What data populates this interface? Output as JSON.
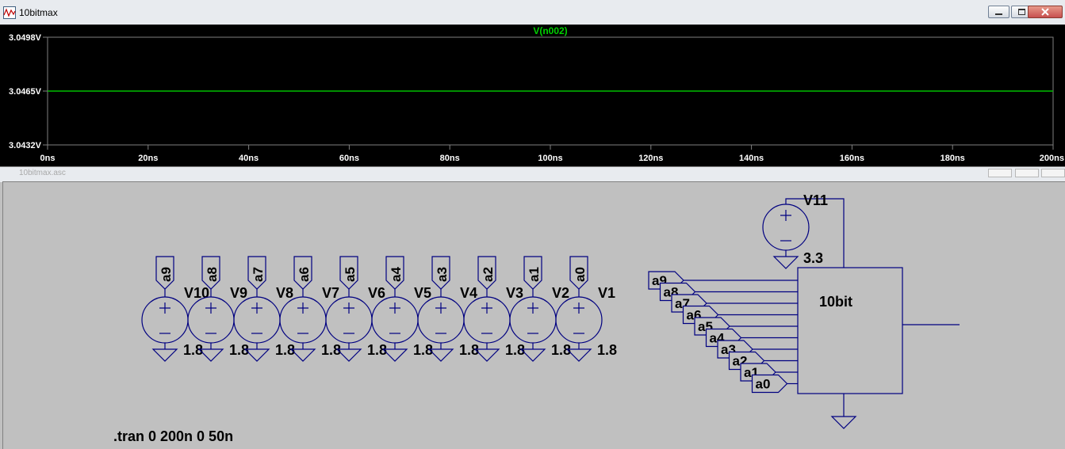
{
  "window": {
    "title": "10bitmax",
    "schematic_title": "10bitmax.asc"
  },
  "plot": {
    "trace_label": "V(n002)",
    "y_ticks": [
      "3.0498V",
      "3.0465V",
      "3.0432V"
    ],
    "x_ticks": [
      "0ns",
      "20ns",
      "40ns",
      "60ns",
      "80ns",
      "100ns",
      "120ns",
      "140ns",
      "160ns",
      "180ns",
      "200ns"
    ],
    "colors": {
      "background": "#000000",
      "grid": "#808080",
      "trace": "#00c000",
      "text": "#ffffff"
    }
  },
  "chart_data": {
    "type": "line",
    "title": "V(n002)",
    "xlabel": "",
    "ylabel": "",
    "x": [
      0,
      200
    ],
    "series": [
      {
        "name": "V(n002)",
        "values": [
          3.0465,
          3.0465
        ]
      }
    ],
    "xlim": [
      0,
      200
    ],
    "ylim": [
      3.0432,
      3.0498
    ],
    "grid": false
  },
  "schematic": {
    "sources": [
      {
        "name": "V10",
        "node": "a9",
        "value": "1.8"
      },
      {
        "name": "V9",
        "node": "a8",
        "value": "1.8"
      },
      {
        "name": "V8",
        "node": "a7",
        "value": "1.8"
      },
      {
        "name": "V7",
        "node": "a6",
        "value": "1.8"
      },
      {
        "name": "V6",
        "node": "a5",
        "value": "1.8"
      },
      {
        "name": "V5",
        "node": "a4",
        "value": "1.8"
      },
      {
        "name": "V4",
        "node": "a3",
        "value": "1.8"
      },
      {
        "name": "V3",
        "node": "a2",
        "value": "1.8"
      },
      {
        "name": "V2",
        "node": "a1",
        "value": "1.8"
      },
      {
        "name": "V1",
        "node": "a0",
        "value": "1.8"
      }
    ],
    "supply": {
      "name": "V11",
      "value": "3.3"
    },
    "block_name": "10bit",
    "input_labels": [
      "a9",
      "a8",
      "a7",
      "a6",
      "a5",
      "a4",
      "a3",
      "a2",
      "a1",
      "a0"
    ],
    "directive": ".tran 0 200n 0 50n",
    "colors": {
      "wire": "#000080",
      "text": "#000000"
    }
  }
}
